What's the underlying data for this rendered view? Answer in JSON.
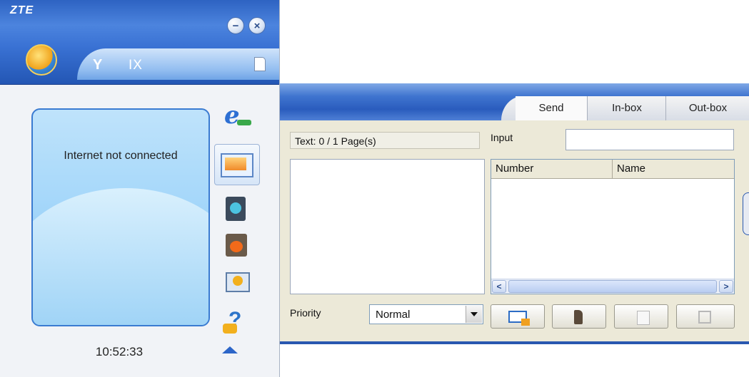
{
  "app": {
    "brand": "ZTE",
    "network": "IX",
    "connection_status": "Internet not connected",
    "clock": "10:52:33"
  },
  "icons": {
    "app_logo": "globe-icon",
    "signal": "antenna-icon",
    "sim": "sim-card-icon",
    "sidebar": [
      "internet-icon",
      "sms-icon",
      "phonebook-icon",
      "call-records-icon",
      "settings-icon",
      "help-icon"
    ]
  },
  "sms": {
    "tabs": [
      "Send",
      "In-box",
      "Out-box"
    ],
    "active_tab": "Send",
    "text_counter": "Text: 0 / 1 Page(s)",
    "message_text": "",
    "priority_label": "Priority",
    "priority_value": "Normal",
    "input_label": "Input",
    "input_value": "",
    "columns": [
      "Number",
      "Name"
    ],
    "scroll_grip": "III"
  },
  "colors": {
    "title_bar": "#2e63c2",
    "screen": "#a7d8fa",
    "panel_bg": "#ece9d8"
  }
}
